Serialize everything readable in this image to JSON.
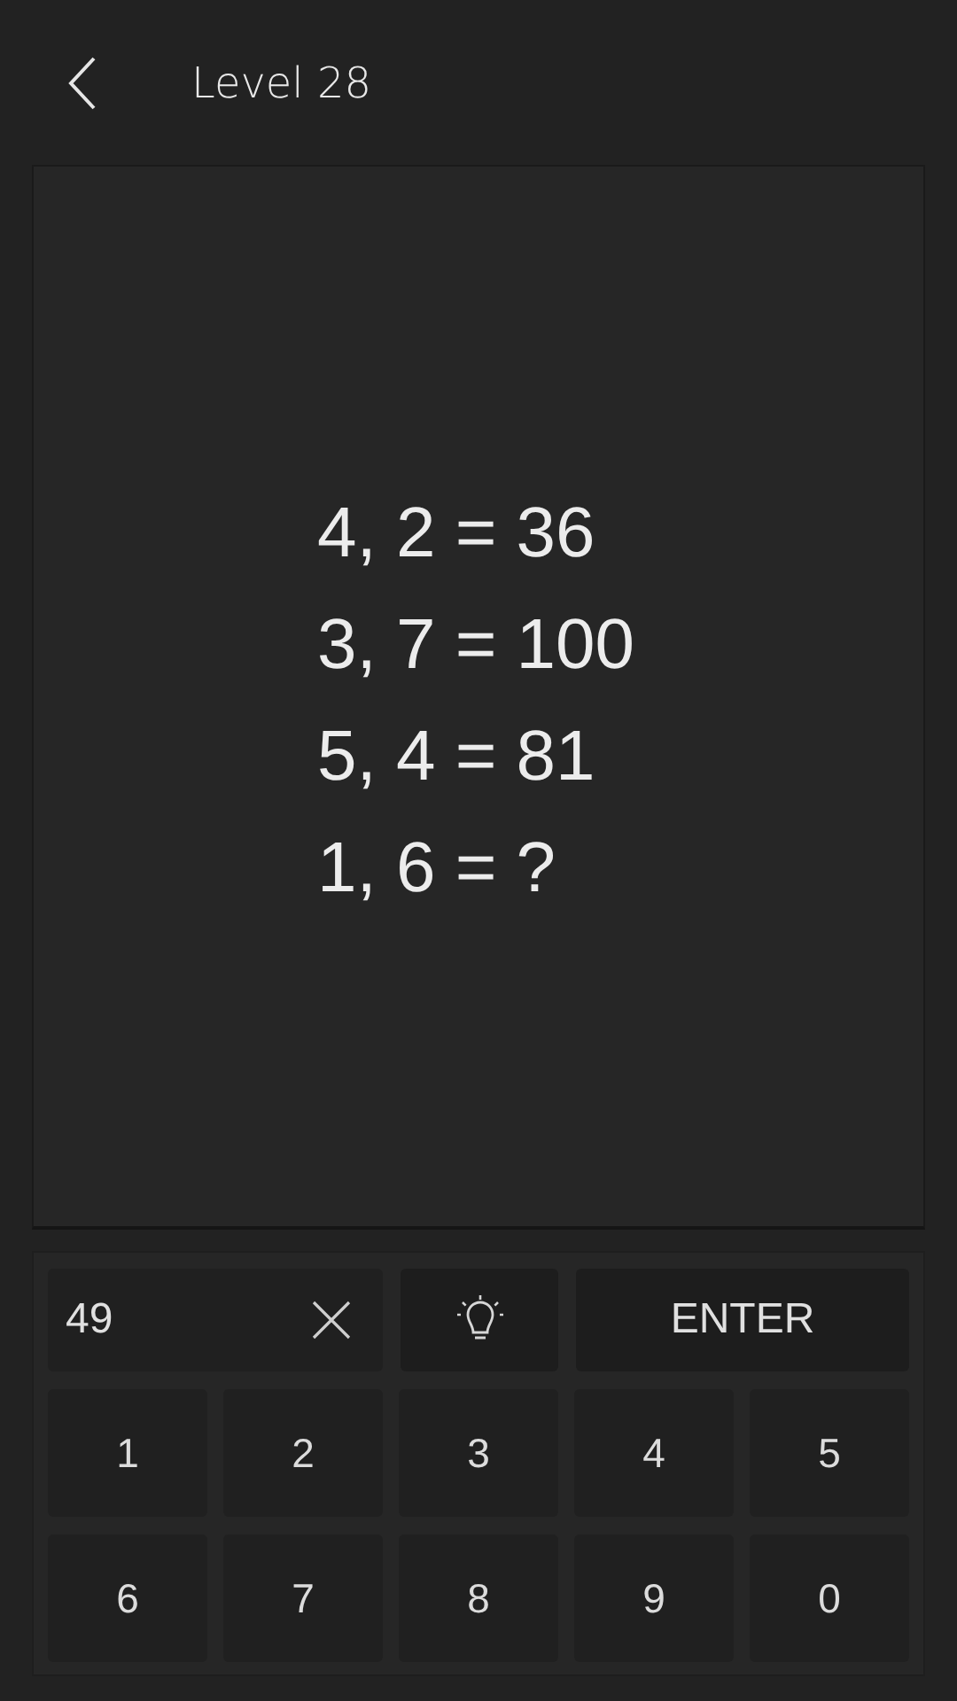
{
  "header": {
    "title": "Level 28"
  },
  "puzzle": {
    "lines": [
      "4, 2 = 36",
      "3, 7 = 100",
      "5, 4 = 81",
      "1, 6 = ?"
    ]
  },
  "answer": {
    "value": "49"
  },
  "enter_button": {
    "label": "ENTER"
  },
  "keys": [
    "1",
    "2",
    "3",
    "4",
    "5",
    "6",
    "7",
    "8",
    "9",
    "0"
  ]
}
